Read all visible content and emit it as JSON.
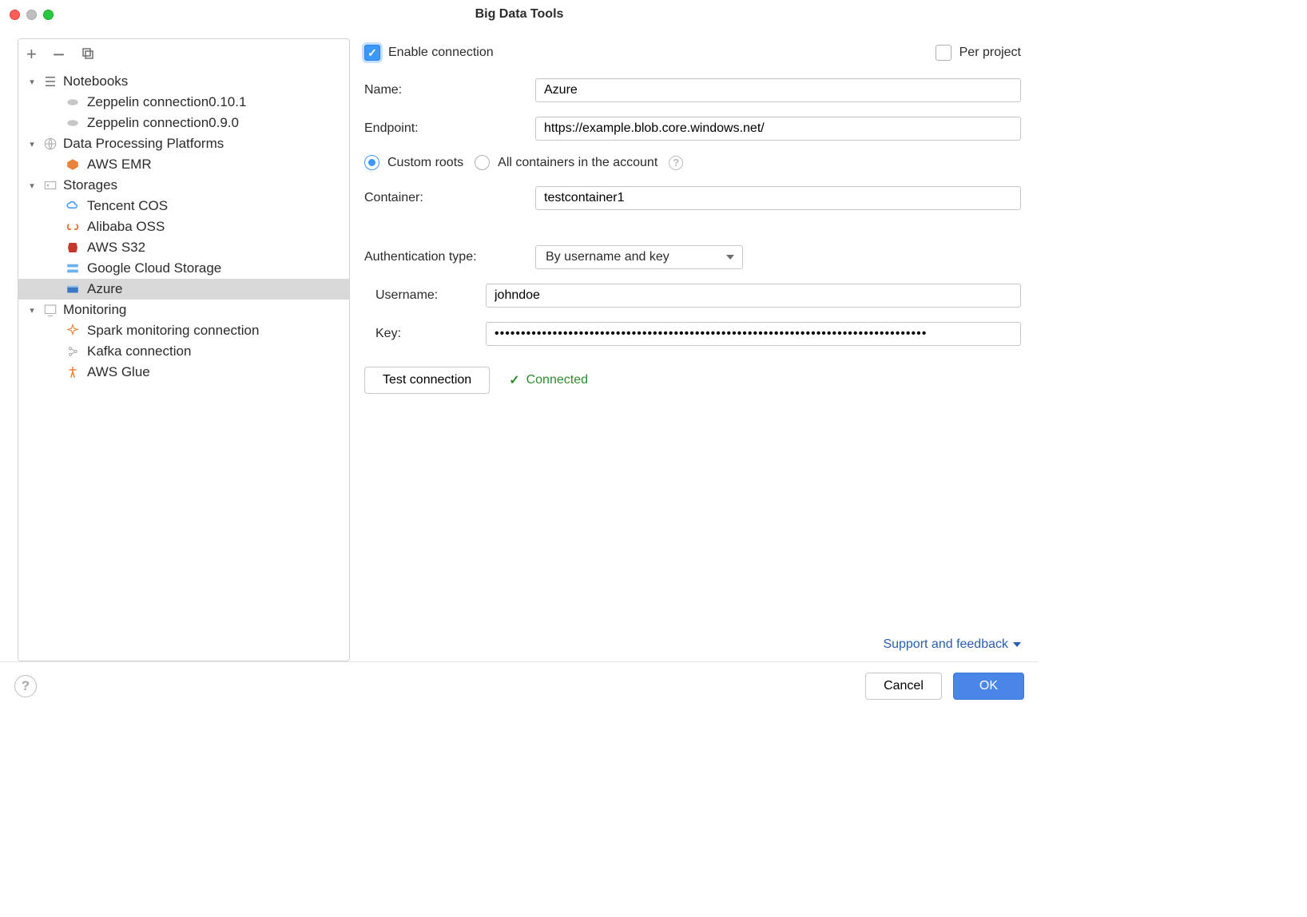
{
  "window": {
    "title": "Big Data Tools"
  },
  "tree": {
    "groups": [
      {
        "label": "Notebooks",
        "items": [
          {
            "label": "Zeppelin connection0.10.1"
          },
          {
            "label": "Zeppelin connection0.9.0"
          }
        ]
      },
      {
        "label": "Data Processing Platforms",
        "items": [
          {
            "label": "AWS EMR"
          }
        ]
      },
      {
        "label": "Storages",
        "items": [
          {
            "label": "Tencent COS"
          },
          {
            "label": "Alibaba OSS"
          },
          {
            "label": "AWS S32"
          },
          {
            "label": "Google Cloud Storage"
          },
          {
            "label": "Azure",
            "selected": true
          }
        ]
      },
      {
        "label": "Monitoring",
        "items": [
          {
            "label": "Spark monitoring connection"
          },
          {
            "label": "Kafka connection"
          },
          {
            "label": "AWS Glue"
          }
        ]
      }
    ]
  },
  "form": {
    "enable_connection_label": "Enable connection",
    "per_project_label": "Per project",
    "name_label": "Name:",
    "name_value": "Azure",
    "endpoint_label": "Endpoint:",
    "endpoint_value": "https://example.blob.core.windows.net/",
    "radio_custom_roots": "Custom roots",
    "radio_all_containers": "All containers in the account",
    "container_label": "Container:",
    "container_value": "testcontainer1",
    "auth_type_label": "Authentication type:",
    "auth_type_value": "By username and key",
    "username_label": "Username:",
    "username_value": "johndoe",
    "key_label": "Key:",
    "key_value": "••••••••••••••••••••••••••••••••••••••••••••••••••••••••••••••••••••••••••••••••••",
    "test_connection_label": "Test connection",
    "connected_label": "Connected",
    "support_label": "Support and feedback"
  },
  "buttons": {
    "cancel": "Cancel",
    "ok": "OK"
  }
}
